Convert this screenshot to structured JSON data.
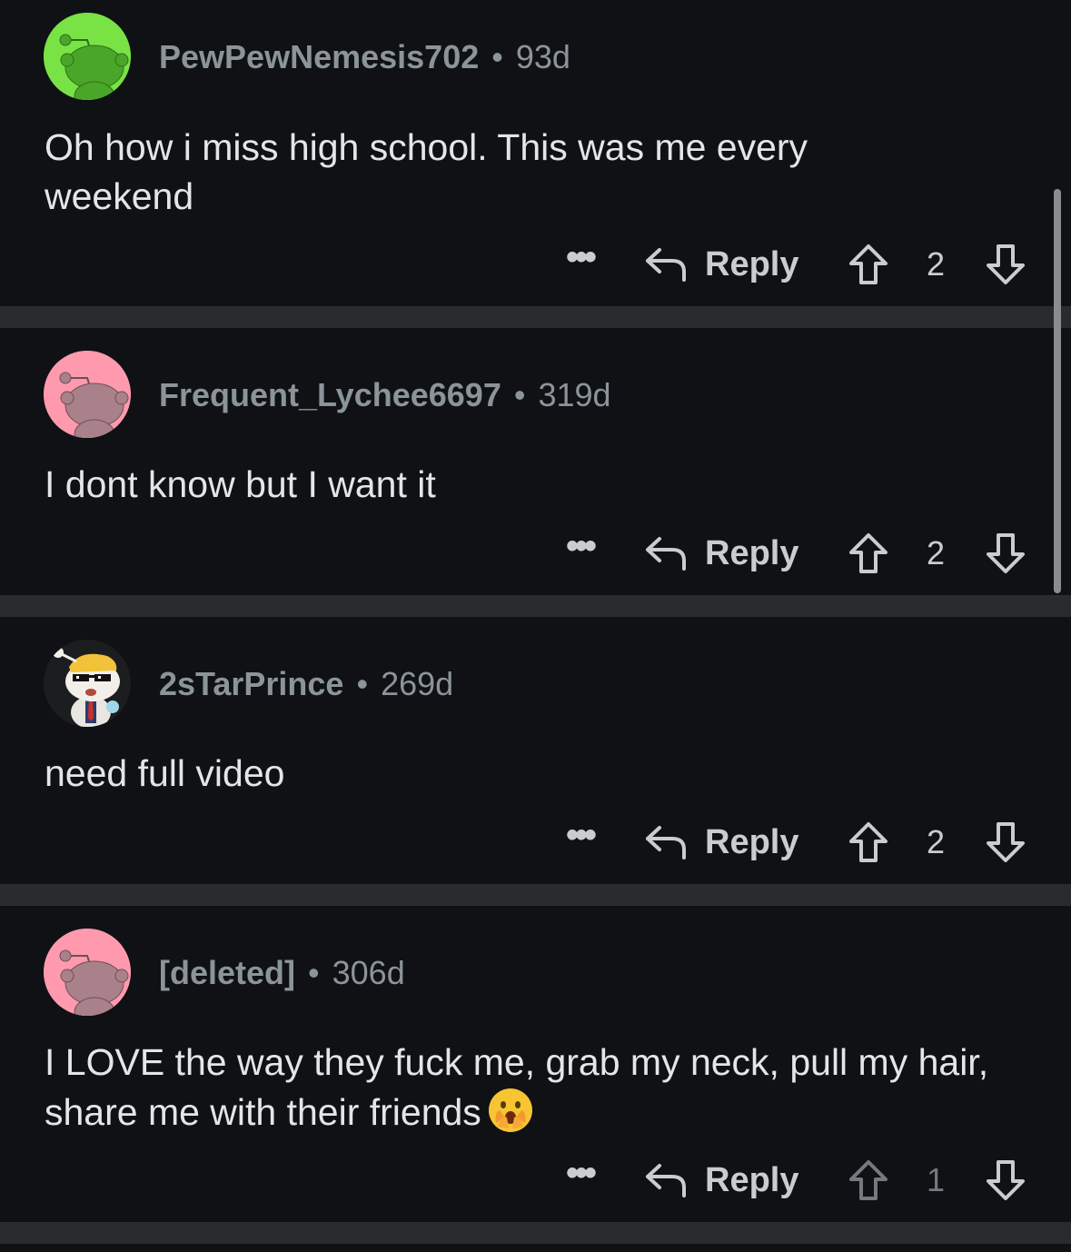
{
  "comments": [
    {
      "username": "PewPewNemesis702",
      "age": "93d",
      "body": "Oh how i miss high school. This was me every weekend",
      "more": "•••",
      "reply": "Reply",
      "votes": "2",
      "avatar_color": "#79e245"
    },
    {
      "username": "Frequent_Lychee6697",
      "age": "319d",
      "body": "I dont know but I want it",
      "more": "•••",
      "reply": "Reply",
      "votes": "2",
      "avatar_color": "#ff9aae"
    },
    {
      "username": "2sTarPrince",
      "age": "269d",
      "body": "need full video",
      "more": "•••",
      "reply": "Reply",
      "votes": "2",
      "avatar_color": "#1c1d1f"
    },
    {
      "username": "[deleted]",
      "age": "306d",
      "body": "I LOVE the way they fuck me, grab my neck, pull my hair, share me with their friends",
      "more": "•••",
      "reply": "Reply",
      "votes": "1",
      "avatar_color": "#ff9aae",
      "emoji": "face-with-open-eyes-and-hand-over-mouth"
    }
  ],
  "separator": "•",
  "colors": {
    "background": "#0f1114",
    "divider": "#2a2b2d",
    "meta_text": "#8b9499",
    "body_text": "#e3e6e8",
    "action_text": "#c9cdd0"
  }
}
